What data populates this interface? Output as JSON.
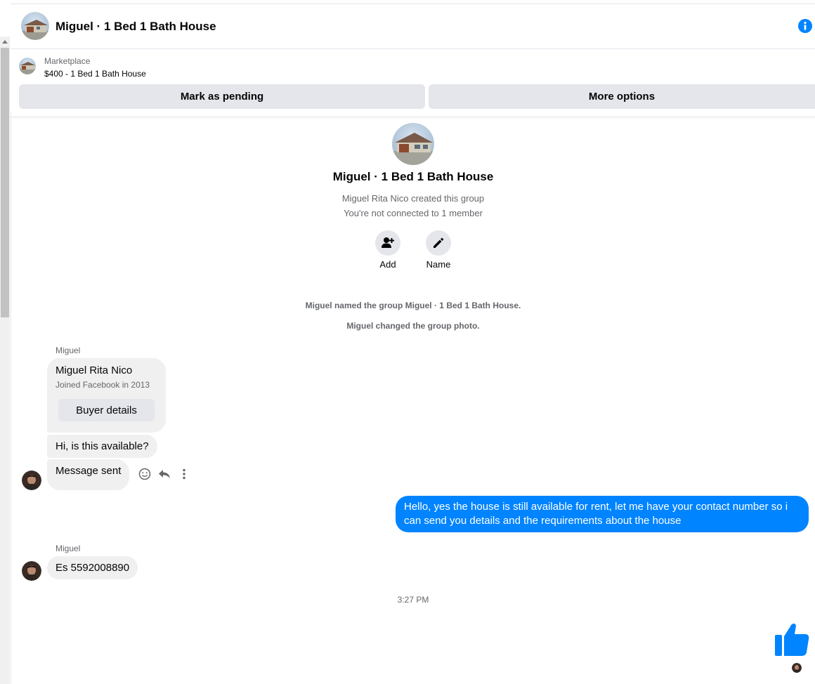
{
  "header": {
    "title": "Miguel · 1 Bed 1 Bath House",
    "info_icon": "info-icon"
  },
  "listing": {
    "source": "Marketplace",
    "title": "$400 - 1 Bed 1 Bath House"
  },
  "actions": {
    "mark_pending": "Mark as pending",
    "more_options": "More options"
  },
  "group": {
    "title": "Miguel · 1 Bed 1 Bath House",
    "created_by": "Miguel Rita Nico created this group",
    "connection": "You're not connected to 1 member",
    "add_label": "Add",
    "name_label": "Name"
  },
  "system_messages": [
    "Miguel named the group Miguel · 1 Bed 1 Bath House.",
    "Miguel changed the group photo."
  ],
  "messages": {
    "sender1": "Miguel",
    "card": {
      "name": "Miguel Rita Nico",
      "subtitle": "Joined Facebook in 2013",
      "button": "Buyer details"
    },
    "in1": "Hi, is this available?",
    "in2": "Message sent",
    "out1": "Hello, yes the house is still available for rent, let me have your contact number so i can send you details and the requirements about the house",
    "sender2": "Miguel",
    "in3": "Es 5592008890"
  },
  "timestamp": "3:27 PM",
  "colors": {
    "accent": "#0084ff",
    "bubble_in": "#f0f0f0",
    "button_bg": "#e4e6eb",
    "secondary_text": "#65676b"
  }
}
